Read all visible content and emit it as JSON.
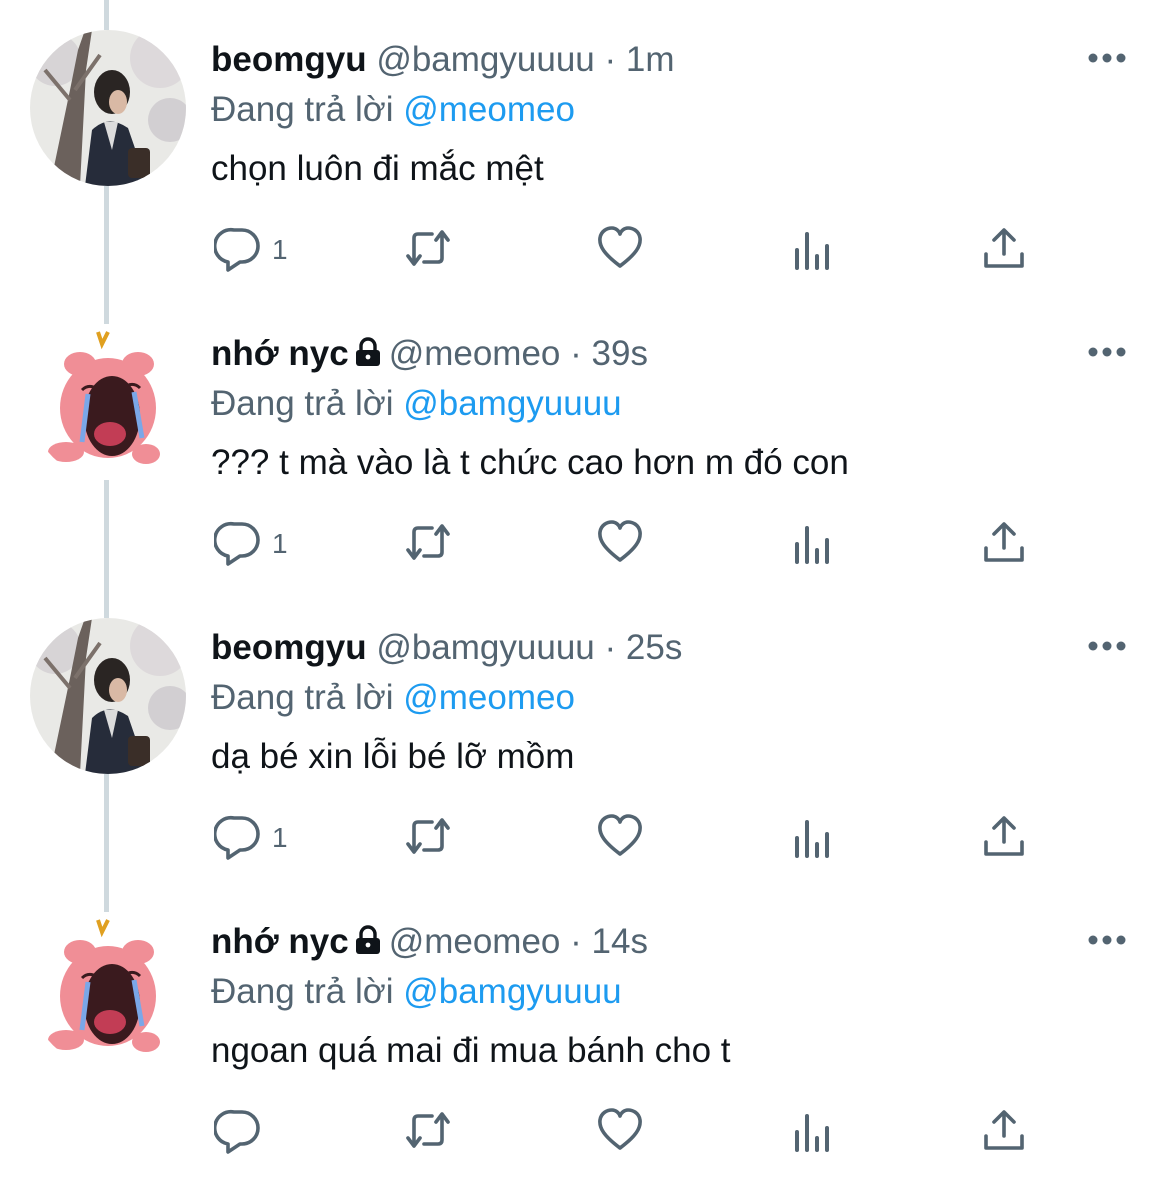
{
  "colors": {
    "text": "#0f1419",
    "secondary": "#536471",
    "accent": "#1d9bf0",
    "thread_line": "#cfd9de"
  },
  "icons": [
    "reply-icon",
    "retweet-icon",
    "like-icon",
    "views-icon",
    "share-icon",
    "more-icon",
    "lock-icon"
  ],
  "tweets": [
    {
      "name": "beomgyu",
      "handle": "@bamgyuuuu",
      "dot": "·",
      "time": "1m",
      "reply_prefix": "Đang trả lời",
      "reply_to": "@meomeo",
      "text": "chọn luôn đi mắc mệt",
      "reply_count": "1",
      "locked": false,
      "avatar": "photo"
    },
    {
      "name": "nhớ nyc",
      "handle": "@meomeo",
      "dot": "·",
      "time": "39s",
      "reply_prefix": "Đang trả lời",
      "reply_to": "@bamgyuuuu",
      "text": "??? t mà vào là t chức cao hơn m đó con",
      "reply_count": "1",
      "locked": true,
      "avatar": "pink-character"
    },
    {
      "name": "beomgyu",
      "handle": "@bamgyuuuu",
      "dot": "·",
      "time": "25s",
      "reply_prefix": "Đang trả lời",
      "reply_to": "@meomeo",
      "text": "dạ bé xin lỗi bé lỡ mồm",
      "reply_count": "1",
      "locked": false,
      "avatar": "photo"
    },
    {
      "name": "nhớ nyc",
      "handle": "@meomeo",
      "dot": "·",
      "time": "14s",
      "reply_prefix": "Đang trả lời",
      "reply_to": "@bamgyuuuu",
      "text": "ngoan quá mai đi mua bánh cho t",
      "reply_count": "",
      "locked": true,
      "avatar": "pink-character"
    }
  ]
}
